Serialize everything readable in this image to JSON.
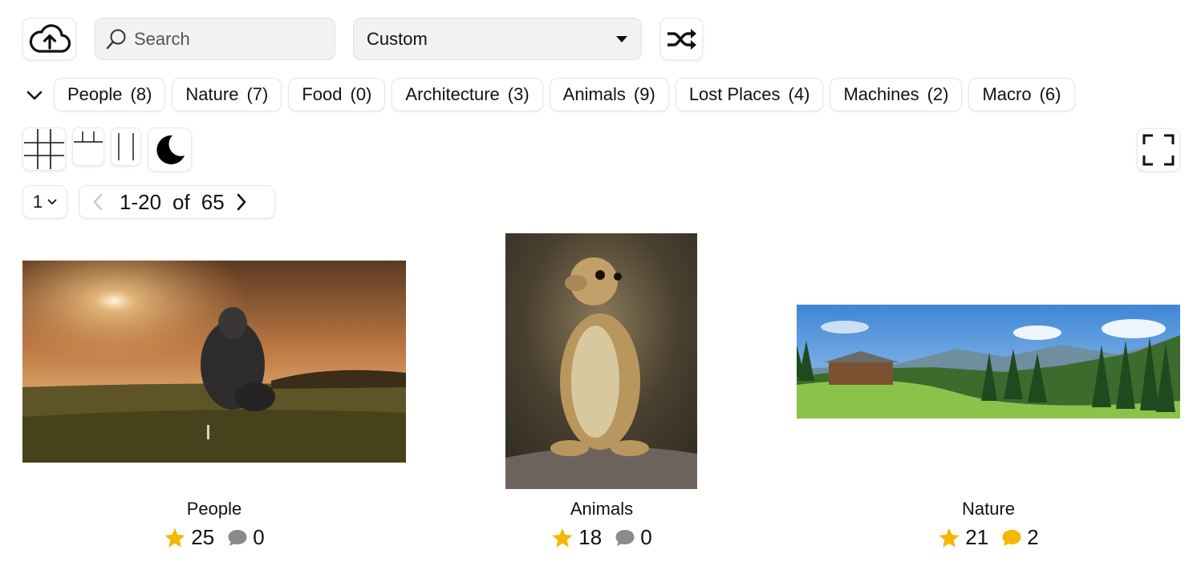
{
  "toolbar": {
    "upload_icon": "cloud-upload-icon",
    "search_placeholder": "Search",
    "sort_value": "Custom",
    "shuffle_icon": "shuffle-icon"
  },
  "categories": [
    {
      "label": "People",
      "count": "(8)"
    },
    {
      "label": "Nature",
      "count": "(7)"
    },
    {
      "label": "Food",
      "count": "(0)"
    },
    {
      "label": "Architecture",
      "count": "(3)"
    },
    {
      "label": "Animals",
      "count": "(9)"
    },
    {
      "label": "Lost Places",
      "count": "(4)"
    },
    {
      "label": "Machines",
      "count": "(2)"
    },
    {
      "label": "Macro",
      "count": "(6)"
    }
  ],
  "view": {
    "grid_icon": "grid-view-icon",
    "rows_icon": "rows-view-icon",
    "columns_icon": "columns-view-icon",
    "dark_mode_icon": "moon-icon",
    "fullscreen_icon": "fullscreen-icon"
  },
  "pagination": {
    "page": "1",
    "range": "1-20",
    "of": "of",
    "total": "65"
  },
  "cards": [
    {
      "title": "People",
      "stars": "25",
      "comments": "0",
      "comment_color": "#8a8a8a"
    },
    {
      "title": "Animals",
      "stars": "18",
      "comments": "0",
      "comment_color": "#8a8a8a"
    },
    {
      "title": "Nature",
      "stars": "21",
      "comments": "2",
      "comment_color": "#f5b800"
    }
  ],
  "colors": {
    "star": "#f5b800",
    "comment_inactive": "#8a8a8a",
    "comment_active": "#f5b800"
  }
}
